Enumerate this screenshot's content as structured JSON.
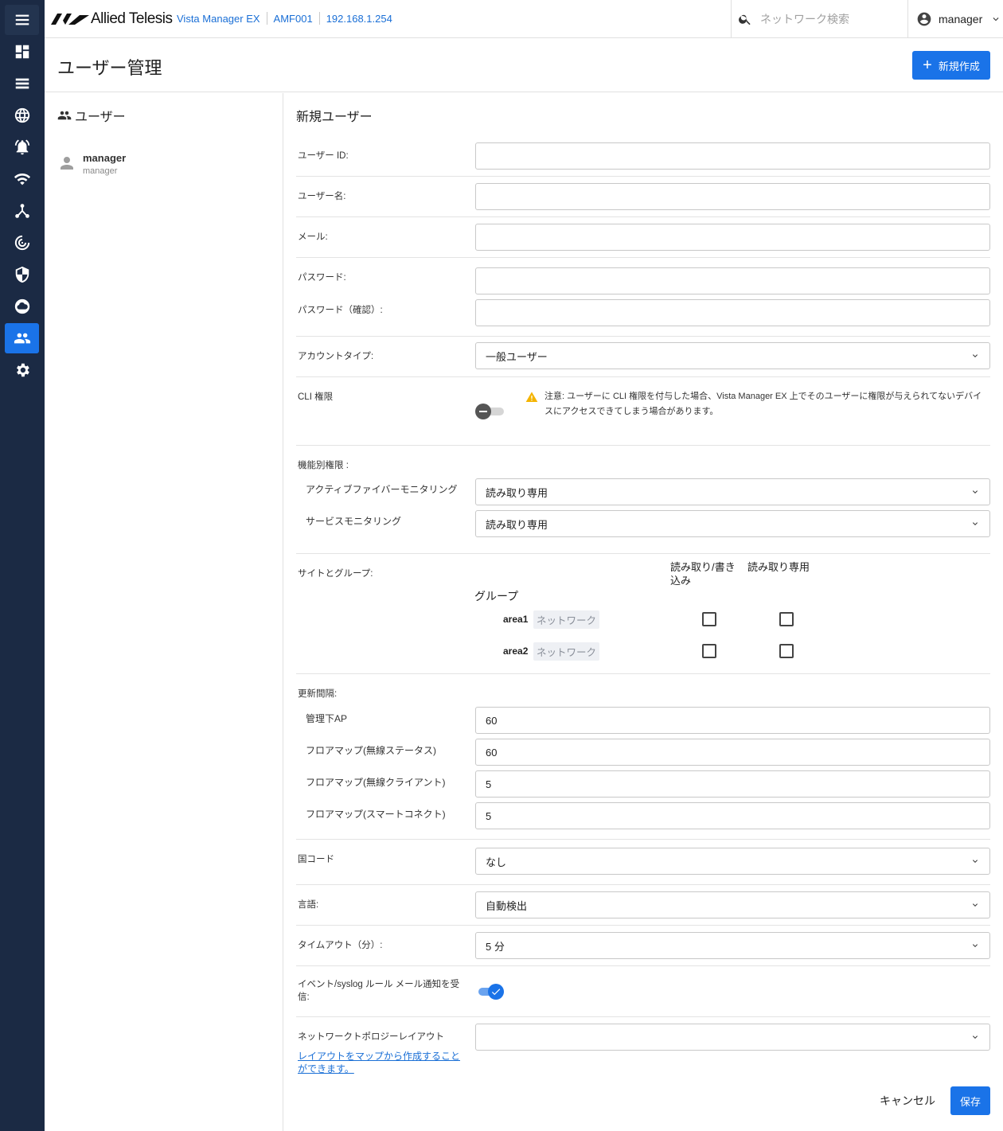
{
  "brand": {
    "name": "Allied Telesis",
    "accent": "#1a73e8",
    "rail_bg": "#1b2a44"
  },
  "breadcrumb": [
    "Vista Manager EX",
    "AMF001",
    "192.168.1.254"
  ],
  "search": {
    "placeholder": "ネットワーク検索"
  },
  "user_menu": {
    "name": "manager"
  },
  "rail": [
    "menu-icon",
    "dashboard-icon",
    "list-icon",
    "globe-icon",
    "alarm-icon",
    "wifi-icon",
    "topology-icon",
    "radar-icon",
    "shield-icon",
    "cloud-icon",
    "users-icon",
    "settings-icon"
  ],
  "page": {
    "title": "ユーザー管理",
    "new_button": "新規作成"
  },
  "users_panel": {
    "title": "ユーザー",
    "items": [
      {
        "name": "manager",
        "role": "manager"
      }
    ]
  },
  "form": {
    "title": "新規ユーザー",
    "user_id_label": "ユーザー ID:",
    "user_id_value": "",
    "user_name_label": "ユーザー名:",
    "user_name_value": "",
    "email_label": "メール:",
    "email_value": "",
    "password_label": "パスワード:",
    "password_value": "",
    "password_confirm_label": "パスワード（確認）:",
    "password_confirm_value": "",
    "account_type_label": "アカウントタイプ:",
    "account_type_value": "一般ユーザー",
    "cli_label": "CLI 権限",
    "cli_enabled": false,
    "cli_warning": "注意: ユーザーに CLI 権限を付与した場合、Vista Manager EX 上でそのユーザーに権限が与えられてないデバイスにアクセスできてしまう場合があります。",
    "feature_label": "機能別権限 :",
    "feature_fiber_label": "アクティブファイバーモニタリング",
    "feature_fiber_value": "読み取り専用",
    "feature_service_label": "サービスモニタリング",
    "feature_service_value": "読み取り専用",
    "sites_label": "サイトとグループ:",
    "col_rw": "読み取り/書き込み",
    "col_ro": "読み取り専用",
    "group_label": "グループ",
    "groups": [
      {
        "name": "area1",
        "tag": "ネットワーク",
        "rw": false,
        "ro": false
      },
      {
        "name": "area2",
        "tag": "ネットワーク",
        "rw": false,
        "ro": false
      }
    ],
    "refresh_label": "更新間隔:",
    "refresh_ap_label": "管理下AP",
    "refresh_ap_value": "60",
    "refresh_status_label": "フロアマップ(無線ステータス)",
    "refresh_status_value": "60",
    "refresh_client_label": "フロアマップ(無線クライアント)",
    "refresh_client_value": "5",
    "refresh_smart_label": "フロアマップ(スマートコネクト)",
    "refresh_smart_value": "5",
    "country_label": "国コード",
    "country_value": "なし",
    "language_label": "言語:",
    "language_value": "自動検出",
    "timeout_label": "タイムアウト（分）:",
    "timeout_value": "5 分",
    "event_label": "イベント/syslog ルール メール通知を受信:",
    "event_enabled": true,
    "layout_label": "ネットワークトポロジーレイアウト",
    "layout_value": "",
    "layout_link": "レイアウトをマップから作成することができます。",
    "cancel": "キャンセル",
    "save": "保存"
  }
}
